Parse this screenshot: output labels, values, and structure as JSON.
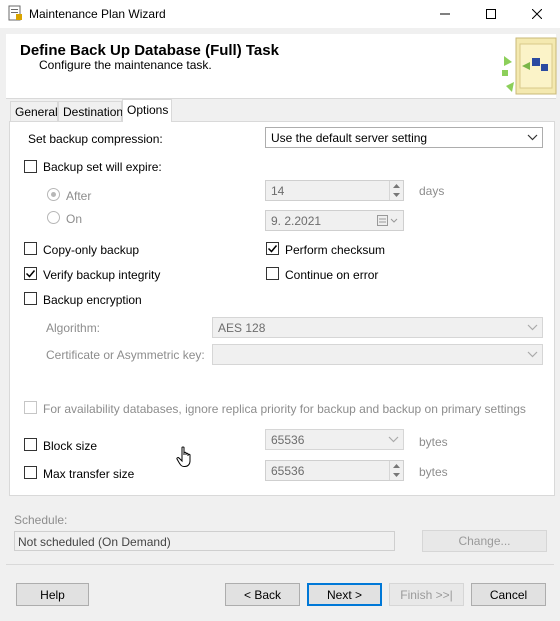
{
  "window": {
    "title": "Maintenance Plan Wizard"
  },
  "header": {
    "title": "Define Back Up Database (Full) Task",
    "subtitle": "Configure the maintenance task."
  },
  "tabs": [
    {
      "label": "General",
      "active": false
    },
    {
      "label": "Destination",
      "active": false
    },
    {
      "label": "Options",
      "active": true
    }
  ],
  "options": {
    "compression_label": "Set backup compression:",
    "compression_value": "Use the default server setting",
    "expire_label": "Backup set will expire:",
    "expire_checked": false,
    "after_label": "After",
    "after_value": "14",
    "after_unit": "days",
    "on_label": "On",
    "on_value": "9.  2.2021",
    "copy_only_label": "Copy-only backup",
    "copy_only_checked": false,
    "checksum_label": "Perform checksum",
    "checksum_checked": true,
    "verify_label": "Verify backup integrity",
    "verify_checked": true,
    "continue_label": "Continue on error",
    "continue_checked": false,
    "encryption_label": "Backup encryption",
    "encryption_checked": false,
    "algorithm_label": "Algorithm:",
    "algorithm_value": "AES 128",
    "cert_label": "Certificate or Asymmetric key:",
    "cert_value": "",
    "availability_label": "For availability databases, ignore replica priority for backup and backup on primary settings",
    "block_size_label": "Block size",
    "block_size_value": "65536",
    "block_size_unit": "bytes",
    "max_transfer_label": "Max transfer size",
    "max_transfer_value": "65536",
    "max_transfer_unit": "bytes"
  },
  "schedule": {
    "label": "Schedule:",
    "value": "Not scheduled (On Demand)",
    "change_button": "Change..."
  },
  "footer": {
    "help": "Help",
    "back": "< Back",
    "next": "Next >",
    "finish": "Finish >>|",
    "cancel": "Cancel"
  },
  "colors": {
    "accent": "#0078d7",
    "disabled_text": "#8d8d8d"
  }
}
